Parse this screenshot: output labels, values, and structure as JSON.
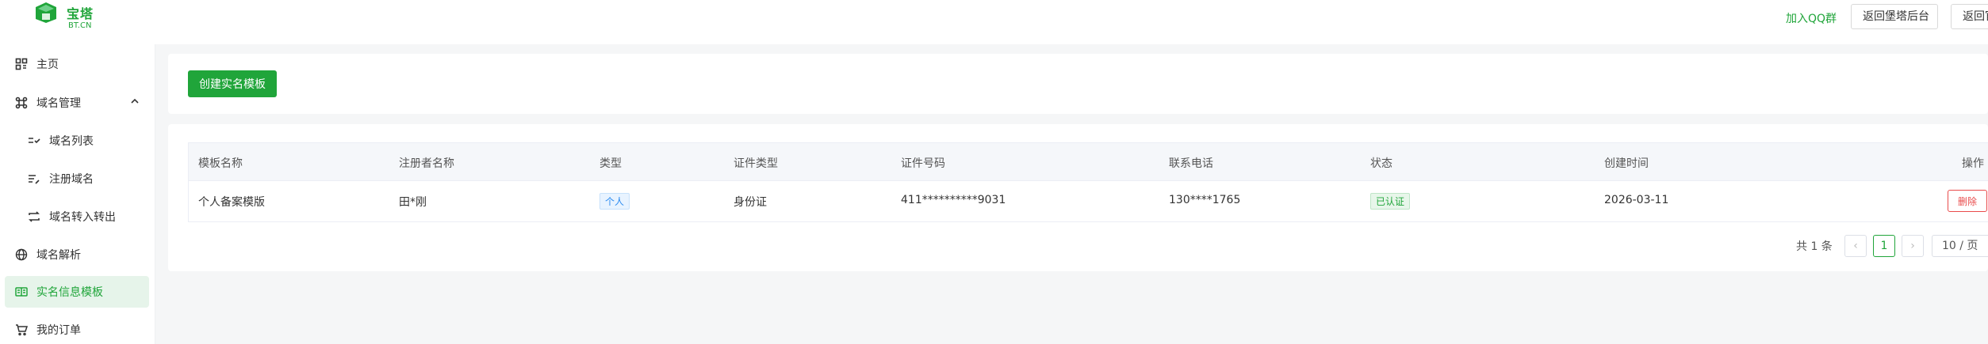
{
  "brand": {
    "name": "宝塔",
    "sub": "BT.CN"
  },
  "header": {
    "qq_link": "加入QQ群",
    "back_btn": "返回堡塔后台",
    "back_btn2": "返回官"
  },
  "sidebar": {
    "items": [
      {
        "label": "主页",
        "icon": "home-grid-icon"
      },
      {
        "label": "域名管理",
        "icon": "command-icon"
      },
      {
        "label": "域名列表",
        "icon": "list-check-icon"
      },
      {
        "label": "注册域名",
        "icon": "list-edit-icon"
      },
      {
        "label": "域名转入转出",
        "icon": "transfer-icon"
      },
      {
        "label": "域名解析",
        "icon": "globe-icon"
      },
      {
        "label": "实名信息模板",
        "icon": "id-card-icon"
      },
      {
        "label": "我的订单",
        "icon": "cart-icon"
      }
    ]
  },
  "toolbar": {
    "create_label": "创建实名模板"
  },
  "table": {
    "headers": [
      "模板名称",
      "注册者名称",
      "类型",
      "证件类型",
      "证件号码",
      "联系电话",
      "状态",
      "创建时间",
      "操作"
    ],
    "rows": [
      {
        "name": "个人备案模版",
        "registrant": "田*刚",
        "type": "个人",
        "id_type": "身份证",
        "id_number": "411**********9031",
        "phone": "130****1765",
        "status": "已认证",
        "created": "2026-03-11",
        "action": "删除"
      }
    ]
  },
  "pagination": {
    "total": "共 1 条",
    "current_page": "1",
    "page_size": "10 / 页",
    "prev": "‹",
    "next": "›"
  },
  "colors": {
    "accent": "#20a53a",
    "danger": "#e94b4b",
    "info": "#2d8cf0"
  }
}
